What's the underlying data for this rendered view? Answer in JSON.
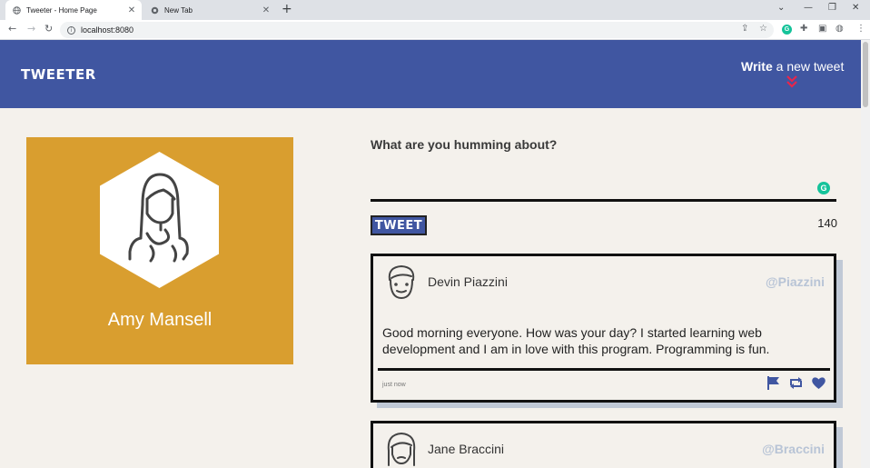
{
  "browser": {
    "tabs": [
      {
        "title": "Tweeter - Home Page",
        "active": true
      },
      {
        "title": "New Tab",
        "active": false
      }
    ],
    "url": "localhost:8080"
  },
  "header": {
    "brand": "TWEETER",
    "write_bold": "Write",
    "write_rest": " a new tweet",
    "accent": "#e8264b",
    "bg": "#4056a1"
  },
  "profile": {
    "name": "Amy Mansell",
    "bg": "#d99e2f"
  },
  "compose": {
    "prompt": "What are you humming about?",
    "button": "TWEET",
    "counter": "140"
  },
  "tweets": [
    {
      "name": "Devin Piazzini",
      "handle": "@Piazzini",
      "body": "Good morning everyone. How was your day? I started learning web development and I am in love with this program. Programming is fun.",
      "time": "just now",
      "actions": [
        "flag-icon",
        "retweet-icon",
        "heart-icon"
      ]
    },
    {
      "name": "Jane Braccini",
      "handle": "@Braccini"
    }
  ]
}
